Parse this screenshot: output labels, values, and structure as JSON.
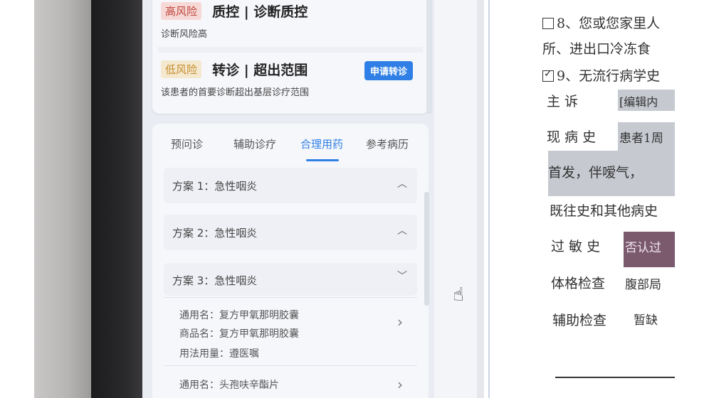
{
  "risk_panel": {
    "high": {
      "badge": "高风险",
      "title": "质控 | 诊断质控",
      "desc": "诊断风险高"
    },
    "low": {
      "badge": "低风险",
      "title": "转诊 | 超出范围",
      "desc": "该患者的首要诊断超出基层诊疗范围",
      "button": "申请转诊"
    }
  },
  "tabs": [
    "预问诊",
    "辅助诊疗",
    "合理用药",
    "参考病历"
  ],
  "active_tab": "合理用药",
  "plans": [
    {
      "label": "方案 1：急性咽炎",
      "chevron": "^"
    },
    {
      "label": "方案 2：急性咽炎",
      "chevron": "^"
    },
    {
      "label": "方案 3：急性咽炎",
      "chevron": "v"
    }
  ],
  "drugs": [
    {
      "generic": "通用名：复方甲氧那明胶囊",
      "brand": "商品名：复方甲氧那明胶囊",
      "usage": "用法用量：遵医嘱"
    },
    {
      "generic": "通用名：头孢呋辛酯片"
    }
  ],
  "document": {
    "q8": "8、您或您家里人",
    "q8_cont": "所、进出口冷冻食",
    "q9": "9、无流行病学史",
    "chief_label": "主   诉",
    "chief_value": "[编辑内",
    "hpi_label": "现 病 史",
    "hpi_value": "患者1周",
    "hpi_line2": "首发，伴嗳气，",
    "history": "既往史和其他病史",
    "allergy_label": "过 敏 史",
    "allergy_value": "否认过",
    "exam_label": "体格检查",
    "exam_value": "腹部局",
    "aux_label": "辅助检查",
    "aux_value": "暂缺"
  },
  "colors": {
    "accent": "#2f7fe6",
    "high_risk": "#c0463c",
    "low_risk": "#c58b2c"
  },
  "icons": [
    "chevron-up-icon",
    "chevron-down-icon",
    "chevron-right-icon",
    "hand-pointer-icon",
    "checkbox-icon"
  ]
}
